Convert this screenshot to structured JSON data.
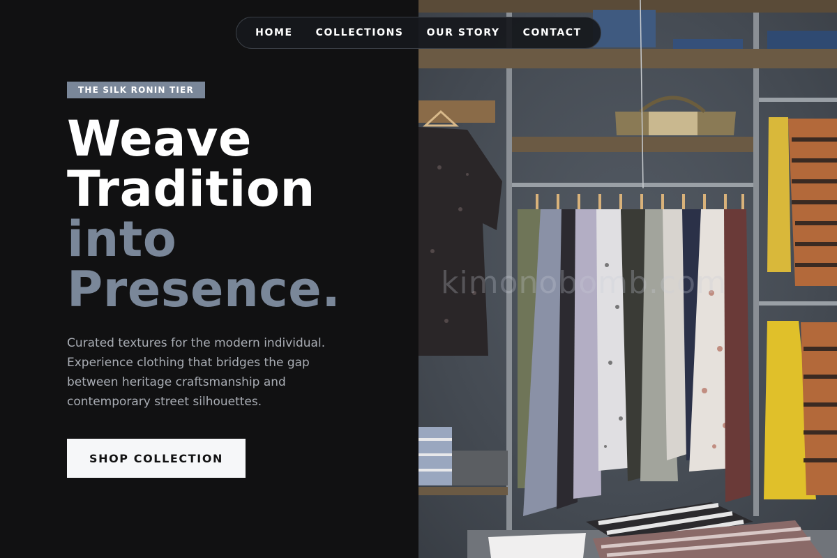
{
  "nav": {
    "items": [
      {
        "label": "HOME"
      },
      {
        "label": "COLLECTIONS"
      },
      {
        "label": "OUR STORY"
      },
      {
        "label": "CONTACT"
      }
    ]
  },
  "hero": {
    "tag": "THE SILK RONIN TIER",
    "headline": {
      "line1": "Weave",
      "line2": "Tradition",
      "line3": "into",
      "line4": "Presence."
    },
    "description": "Curated textures for the modern individual. Experience clothing that bridges the gap between heritage craftsmanship and contemporary street silhouettes.",
    "cta_label": "SHOP COLLECTION"
  },
  "image": {
    "watermark": "kimonobomb.com"
  },
  "colors": {
    "background": "#111112",
    "accent_slate": "#7a8799",
    "headline_white": "#ffffff",
    "button_bg": "#f6f7f9"
  }
}
